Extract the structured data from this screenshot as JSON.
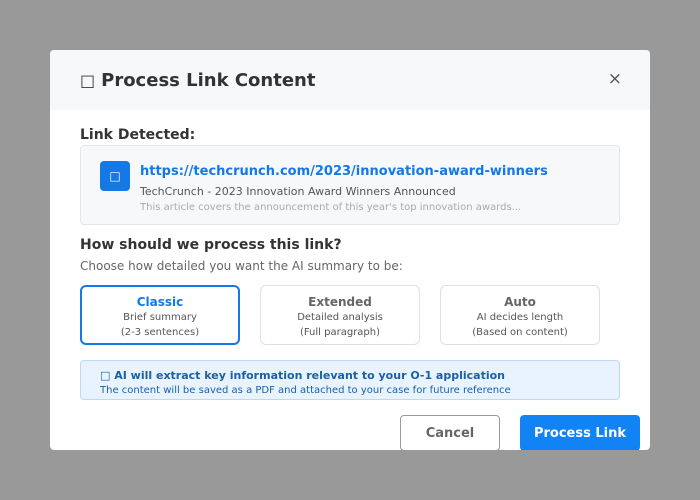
{
  "modal": {
    "title": "Process Link Content",
    "title_icon": "link-icon",
    "close_label": "×"
  },
  "link": {
    "section_label": "Link Detected:",
    "icon": "link-icon",
    "url": "https://techcrunch.com/2023/innovation-award-winners",
    "source": "TechCrunch - 2023 Innovation Award Winners Announced",
    "description": "This article covers the announcement of this year's top innovation awards..."
  },
  "process": {
    "question": "How should we process this link?",
    "subtitle": "Choose how detailed you want the AI summary to be:",
    "selected": "Classic",
    "options": [
      {
        "title": "Classic",
        "line1": "Brief summary",
        "line2": "(2-3 sentences)"
      },
      {
        "title": "Extended",
        "line1": "Detailed analysis",
        "line2": "(Full paragraph)"
      },
      {
        "title": "Auto",
        "line1": "AI decides length",
        "line2": "(Based on content)"
      }
    ]
  },
  "info": {
    "icon": "info-icon",
    "title": "AI will extract key information relevant to your O-1 application",
    "subtitle": "The content will be saved as a PDF and attached to your case for future reference"
  },
  "actions": {
    "cancel_label": "Cancel",
    "submit_label": "Process Link"
  },
  "colors": {
    "accent": "#1478e6",
    "overlay": "#999999"
  }
}
